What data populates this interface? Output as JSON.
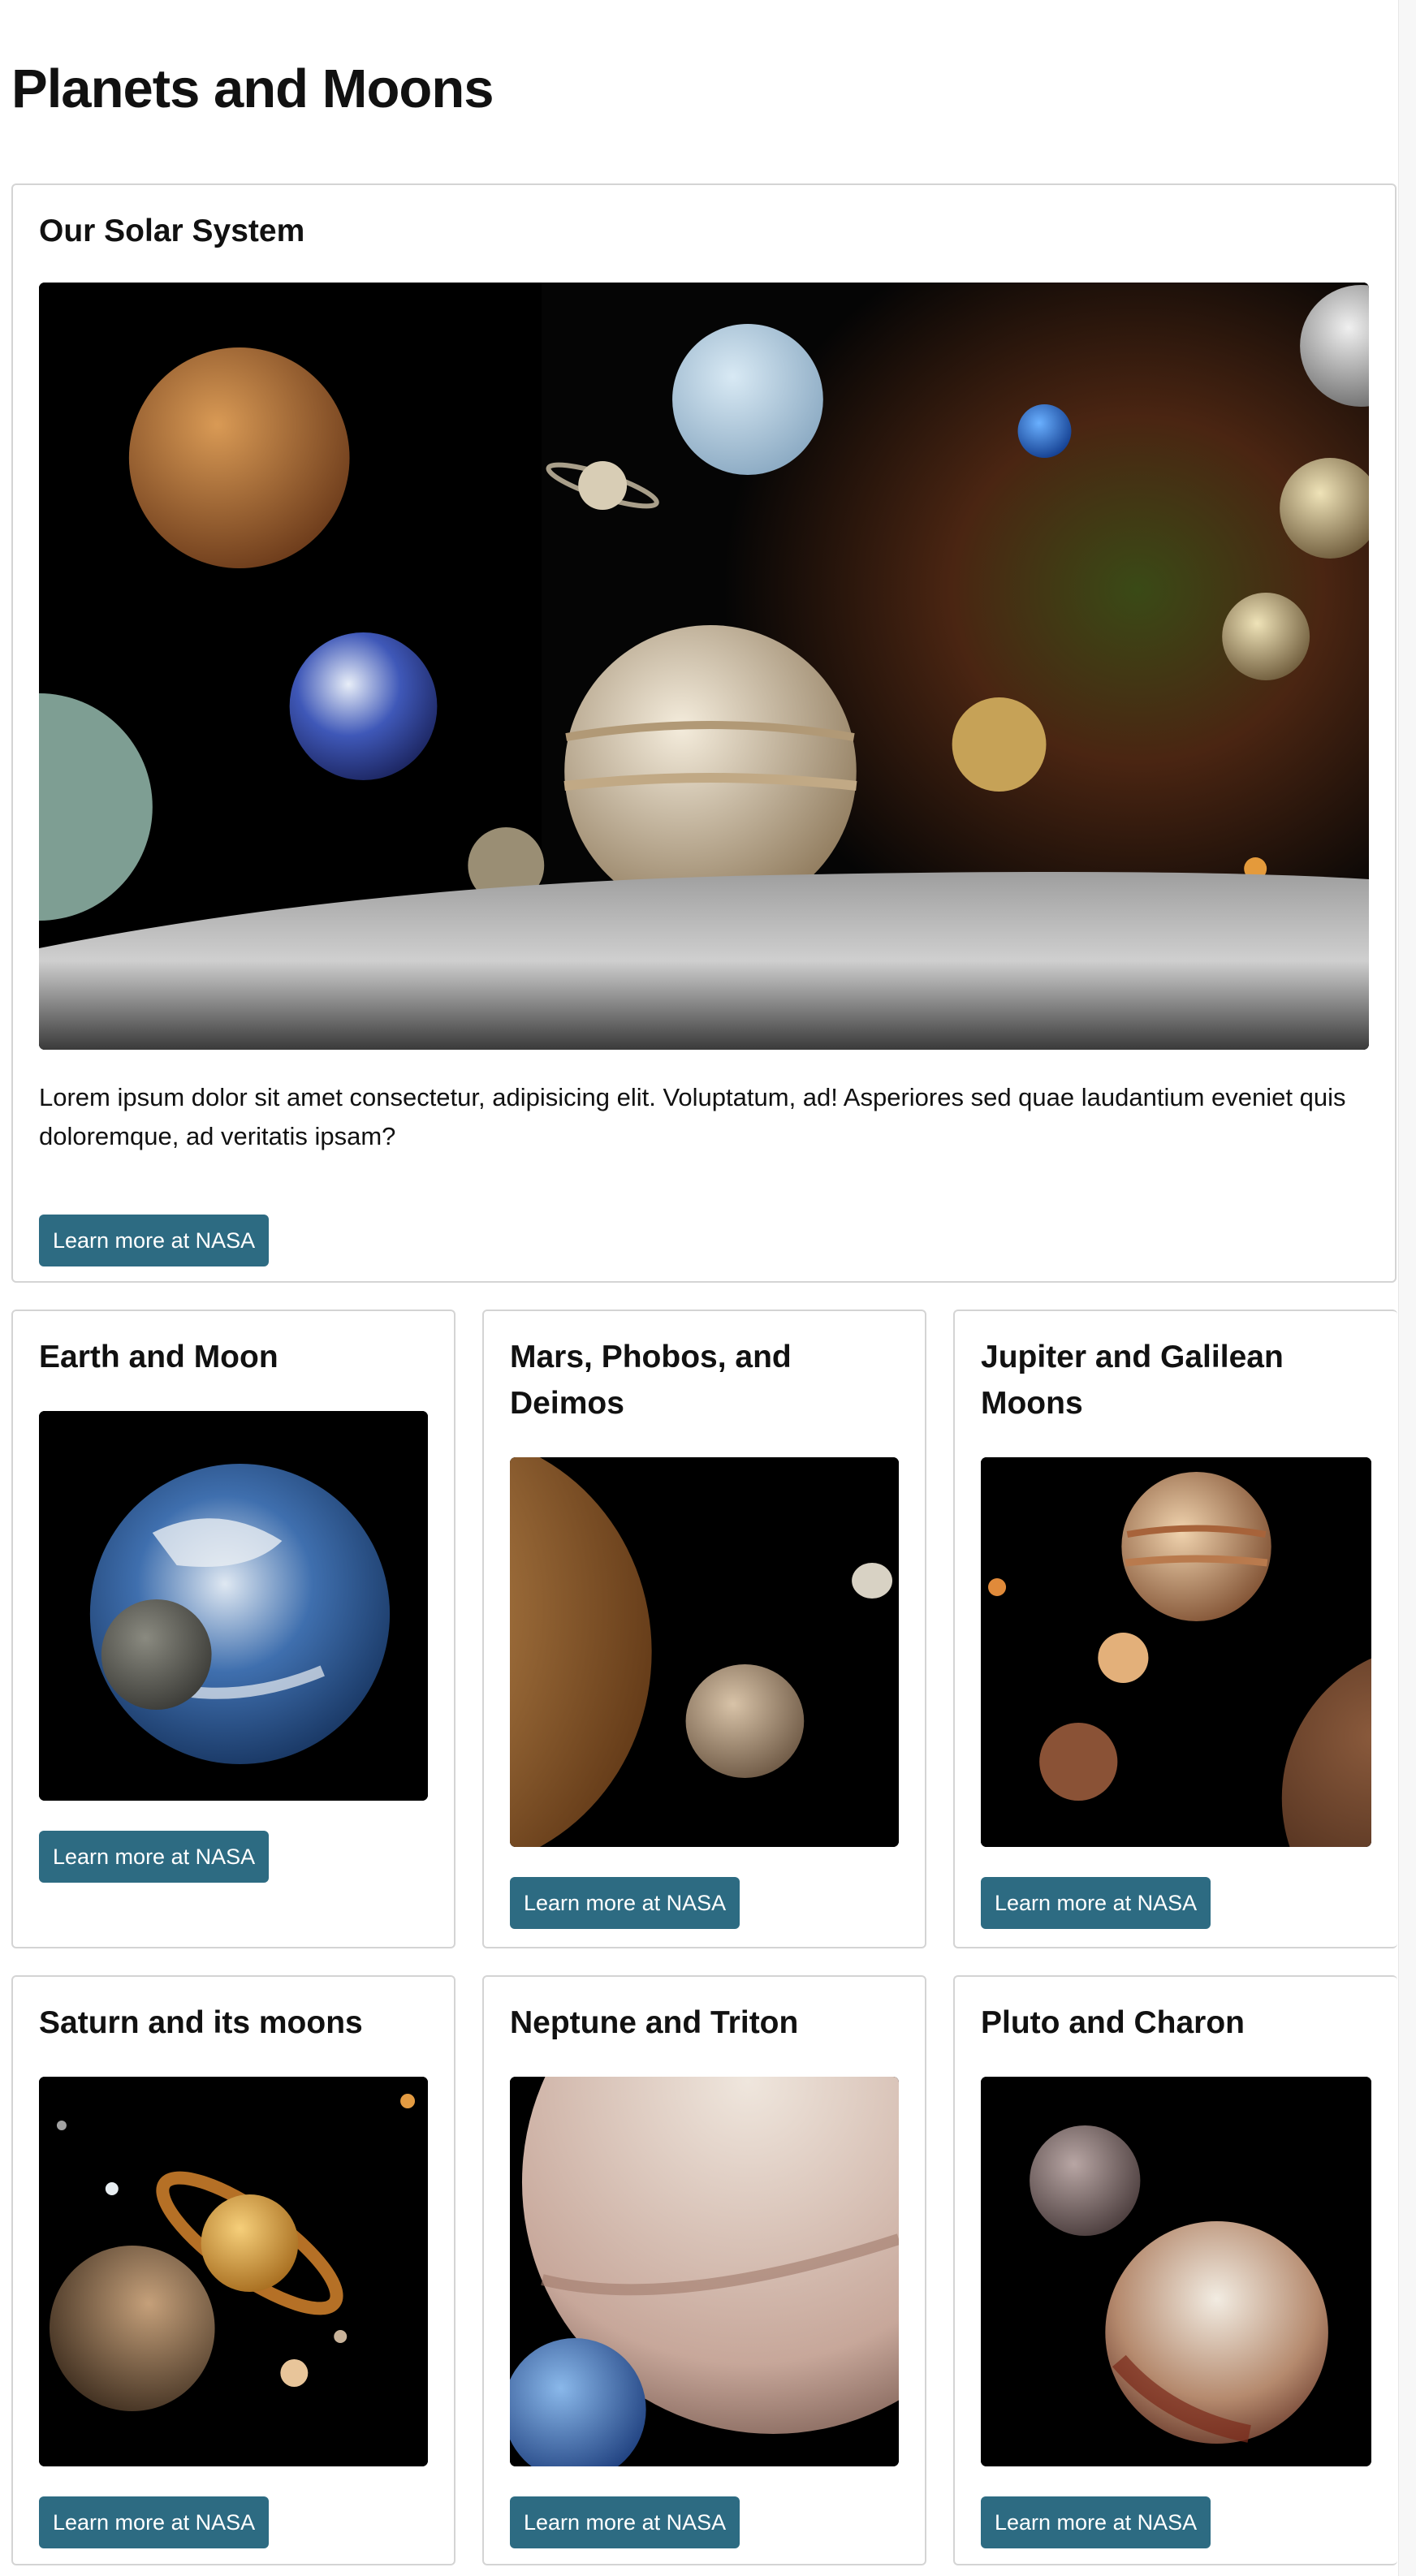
{
  "page": {
    "title": "Planets and Moons"
  },
  "featured": {
    "title": "Our Solar System",
    "text": "Lorem ipsum dolor sit amet consectetur, adipisicing elit. Voluptatum, ad! Asperiores sed quae laudantium eveniet quis doloremque, ad veritatis ipsam?",
    "button_label": "Learn more at NASA"
  },
  "cards": [
    {
      "title": "Earth and Moon",
      "button_label": "Learn more at NASA"
    },
    {
      "title": "Mars, Phobos, and Deimos",
      "button_label": "Learn more at NASA"
    },
    {
      "title": "Jupiter and Galilean Moons",
      "button_label": "Learn more at NASA"
    },
    {
      "title": "Saturn and its moons",
      "button_label": "Learn more at NASA"
    },
    {
      "title": "Neptune and Triton",
      "button_label": "Learn more at NASA"
    },
    {
      "title": "Pluto and Charon",
      "button_label": "Learn more at NASA"
    }
  ],
  "colors": {
    "button": "#2d6b82",
    "card_border": "#d4d4d4"
  }
}
